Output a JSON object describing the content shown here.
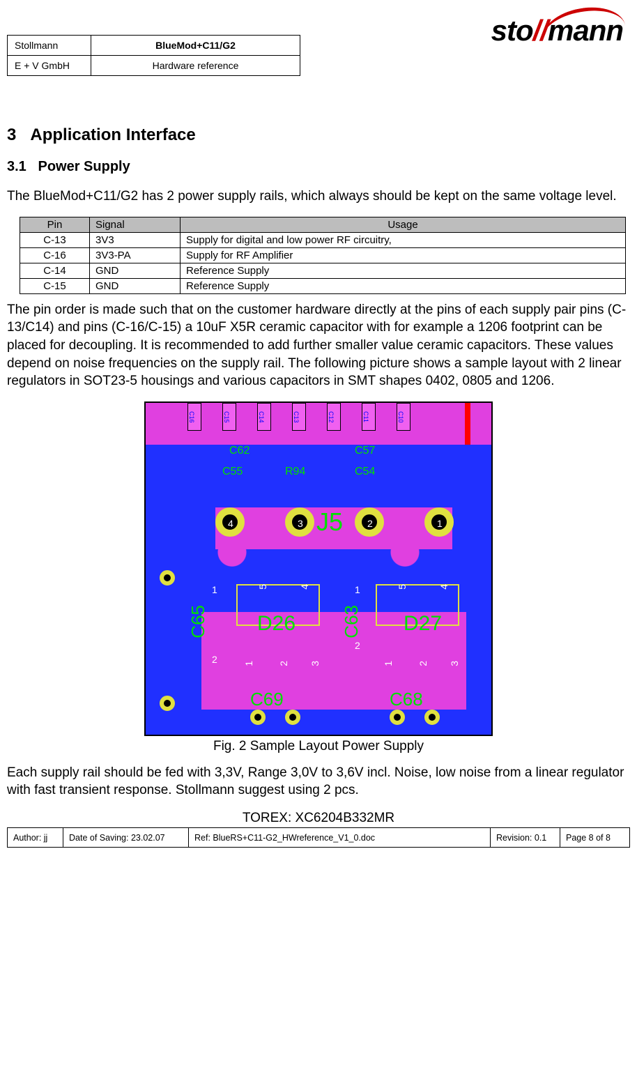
{
  "header": {
    "company_line1": "Stollmann",
    "company_line2": "E + V GmbH",
    "product": "BlueMod+C11/G2",
    "doc_type": "Hardware reference",
    "logo_text_left": "sto",
    "logo_text_right": "mann"
  },
  "section": {
    "num": "3",
    "title": "Application Interface"
  },
  "subsection": {
    "num": "3.1",
    "title": "Power Supply"
  },
  "intro_para": "The BlueMod+C11/G2 has 2 power supply rails, which always should be kept on the same voltage level.",
  "pin_table": {
    "headers": [
      "Pin",
      "Signal",
      "Usage"
    ],
    "rows": [
      {
        "pin": "C-13",
        "signal": "3V3",
        "usage": "Supply for digital and low power RF circuitry,"
      },
      {
        "pin": "C-16",
        "signal": "3V3-PA",
        "usage": "Supply for RF Amplifier"
      },
      {
        "pin": "C-14",
        "signal": "GND",
        "usage": "Reference Supply"
      },
      {
        "pin": "C-15",
        "signal": "GND",
        "usage": "Reference Supply"
      }
    ]
  },
  "para2": "The pin order is made such that on the customer hardware directly at the pins of each supply pair pins (C-13/C14) and pins (C-16/C-15) a 10uF X5R ceramic capacitor with for example a 1206 footprint can be placed for decoupling. It is recommended to add further smaller value ceramic capacitors. These values depend on noise frequencies on the supply rail. The following picture shows a sample layout with 2 linear regulators in SOT23-5 housings and various capacitors in SMT shapes 0402, 0805 and 1206.",
  "figure": {
    "caption": "Fig. 2 Sample Layout Power Supply",
    "top_pads": [
      "C16",
      "C15",
      "C14",
      "C13",
      "C12",
      "C11",
      "C10"
    ],
    "comp_row_top": [
      "C62",
      "C57"
    ],
    "comp_row_mid": [
      "C55",
      "R94",
      "C54"
    ],
    "header_num": [
      "4",
      "3",
      "2",
      "1"
    ],
    "header_ref": "J5",
    "left_cap_ref": "C65",
    "left_cap_pins": [
      "1",
      "2"
    ],
    "reg_left_ref": "D26",
    "reg_right_ref": "D27",
    "reg_pins_group1": [
      "5",
      "4"
    ],
    "reg_pins_group2": [
      "1",
      "2",
      "3"
    ],
    "mid_cap_ref": "C63",
    "mid_cap_pins": [
      "1",
      "2"
    ],
    "bottom_left_ref": "C69",
    "bottom_right_ref": "C68"
  },
  "para3": "Each supply rail should be fed with 3,3V, Range 3,0V to 3,6V incl. Noise, low noise from a linear regulator with fast transient response. Stollmann suggest using 2 pcs.",
  "part_number": "TOREX: XC6204B332MR",
  "footer": {
    "author": "Author: jj",
    "date": "Date of Saving: 23.02.07",
    "ref": "Ref: BlueRS+C11-G2_HWreference_V1_0.doc",
    "revision": "Revision: 0.1",
    "page": "Page 8 of 8"
  }
}
